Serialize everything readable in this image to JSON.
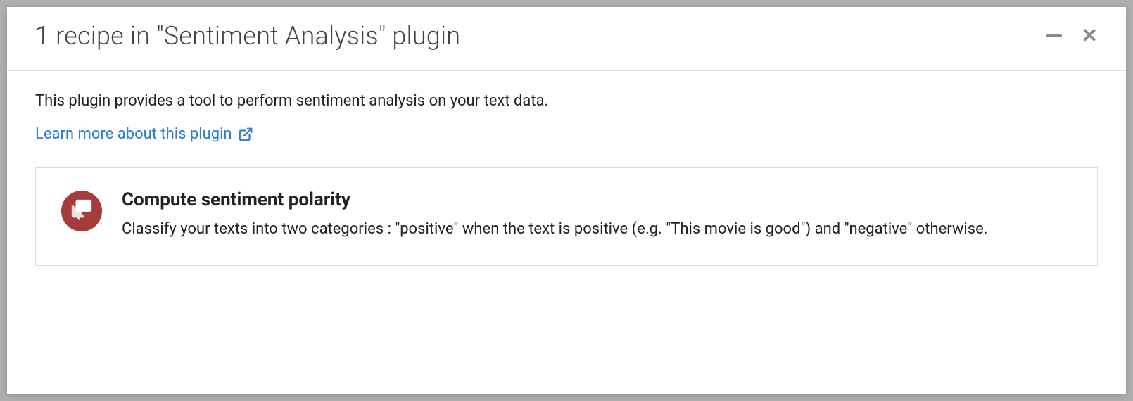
{
  "modal": {
    "title": "1 recipe in \"Sentiment Analysis\" plugin",
    "description": "This plugin provides a tool to perform sentiment analysis on your text data.",
    "learn_more_label": "Learn more about this plugin"
  },
  "recipes": [
    {
      "title": "Compute sentiment polarity",
      "description": "Classify your texts into two categories : \"positive\" when the text is positive (e.g. \"This movie is good\") and \"negative\" otherwise.",
      "icon_color": "#a63b3b"
    }
  ],
  "colors": {
    "link": "#2d7dd2",
    "recipe_icon_bg": "#a63b3b"
  }
}
